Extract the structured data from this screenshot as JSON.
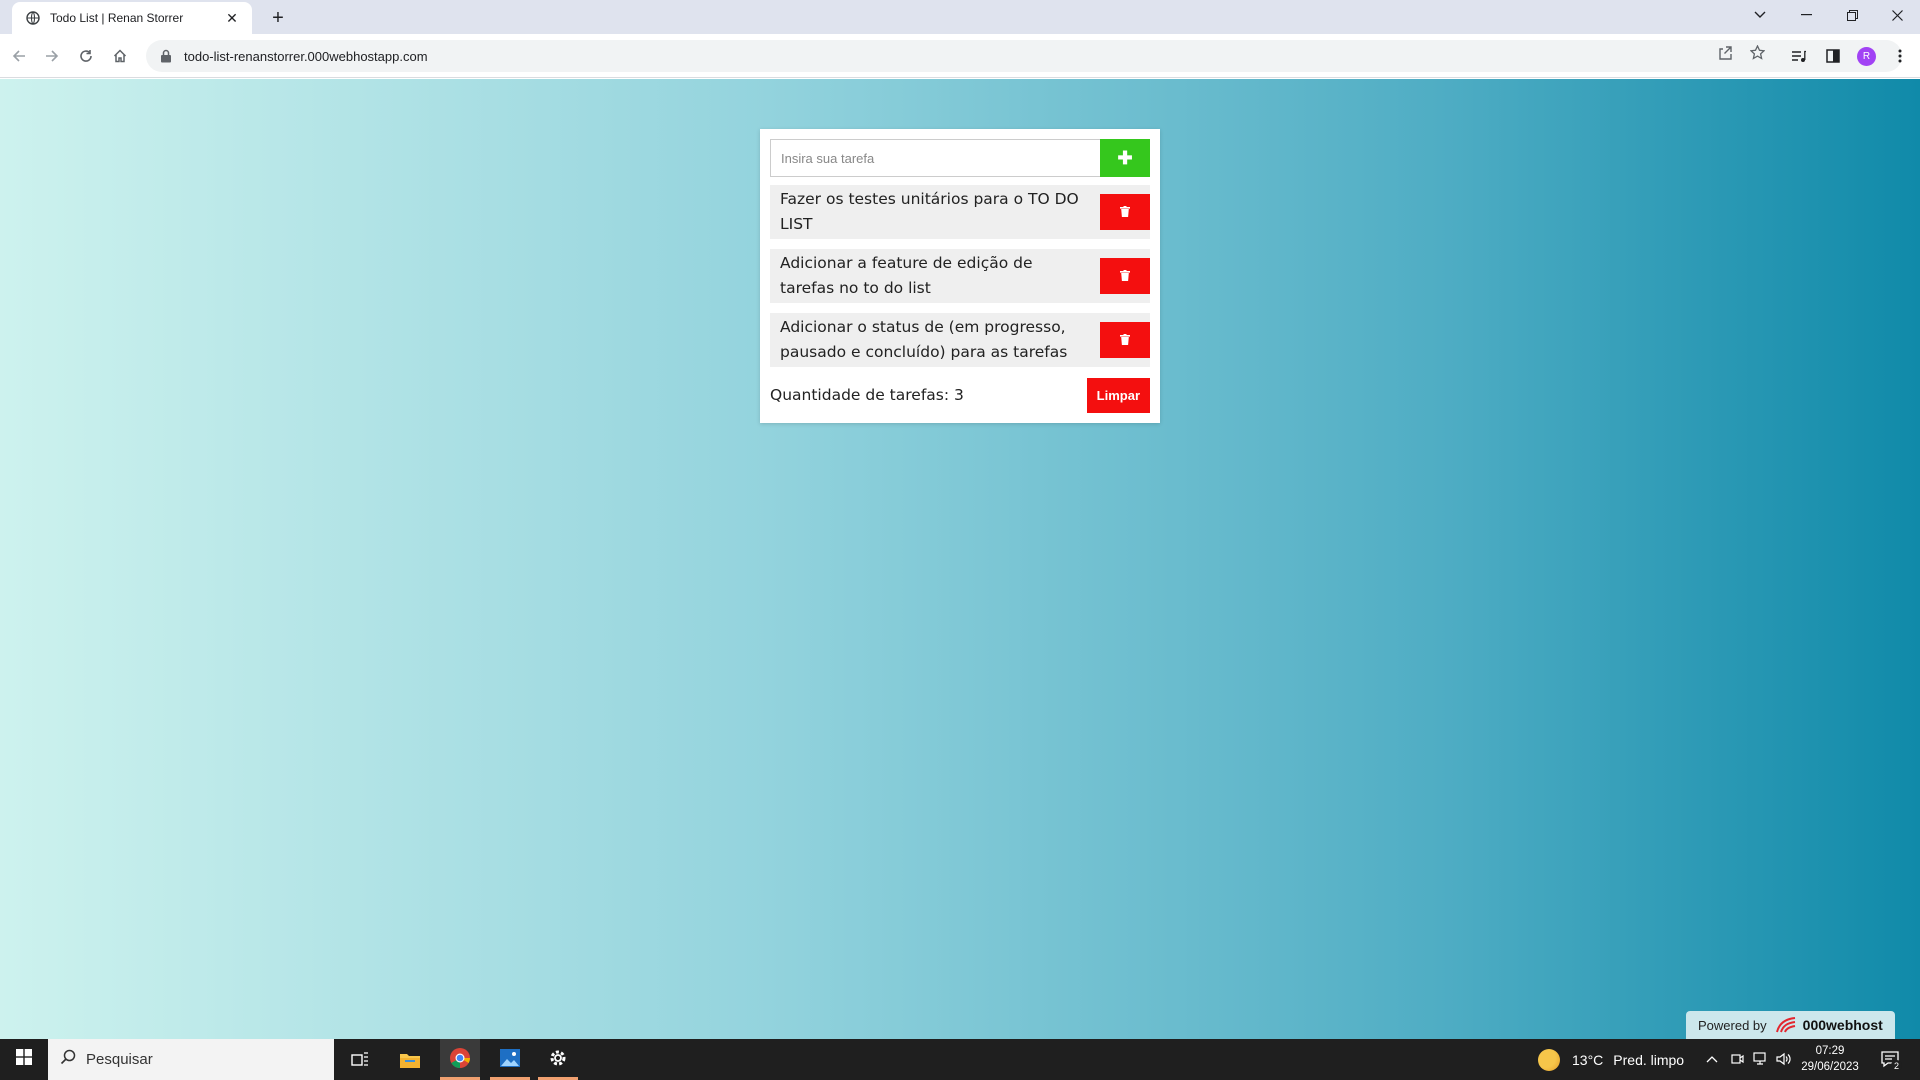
{
  "browser": {
    "tab_title": "Todo List | Renan Storrer",
    "url": "todo-list-renanstorrer.000webhostapp.com",
    "profile_initial": "R",
    "new_tab_symbol": "+",
    "close_symbol": "✕"
  },
  "todo": {
    "input_placeholder": "Insira sua tarefa",
    "add_symbol": "✚",
    "tasks": [
      {
        "text": "Fazer os testes unitários para o TO DO LIST"
      },
      {
        "text": "Adicionar a feature de edição de tarefas no to do list"
      },
      {
        "text": "Adicionar o status de (em progresso, pausado e concluído) para as tarefas"
      }
    ],
    "count_label": "Quantidade de tarefas: 3",
    "clear_label": "Limpar"
  },
  "hosting_badge": {
    "label": "Powered by",
    "brand": "000webhost"
  },
  "taskbar": {
    "search_text": "Pesquisar",
    "weather_temp": "13°C",
    "weather_desc": "Pred. limpo",
    "time": "07:29",
    "date": "29/06/2023",
    "notification_count": "2"
  },
  "colors": {
    "add_button": "#35c71d",
    "delete_button": "#f40f0f",
    "gradient_start": "#cdf2ee",
    "gradient_end": "#108aa9"
  }
}
